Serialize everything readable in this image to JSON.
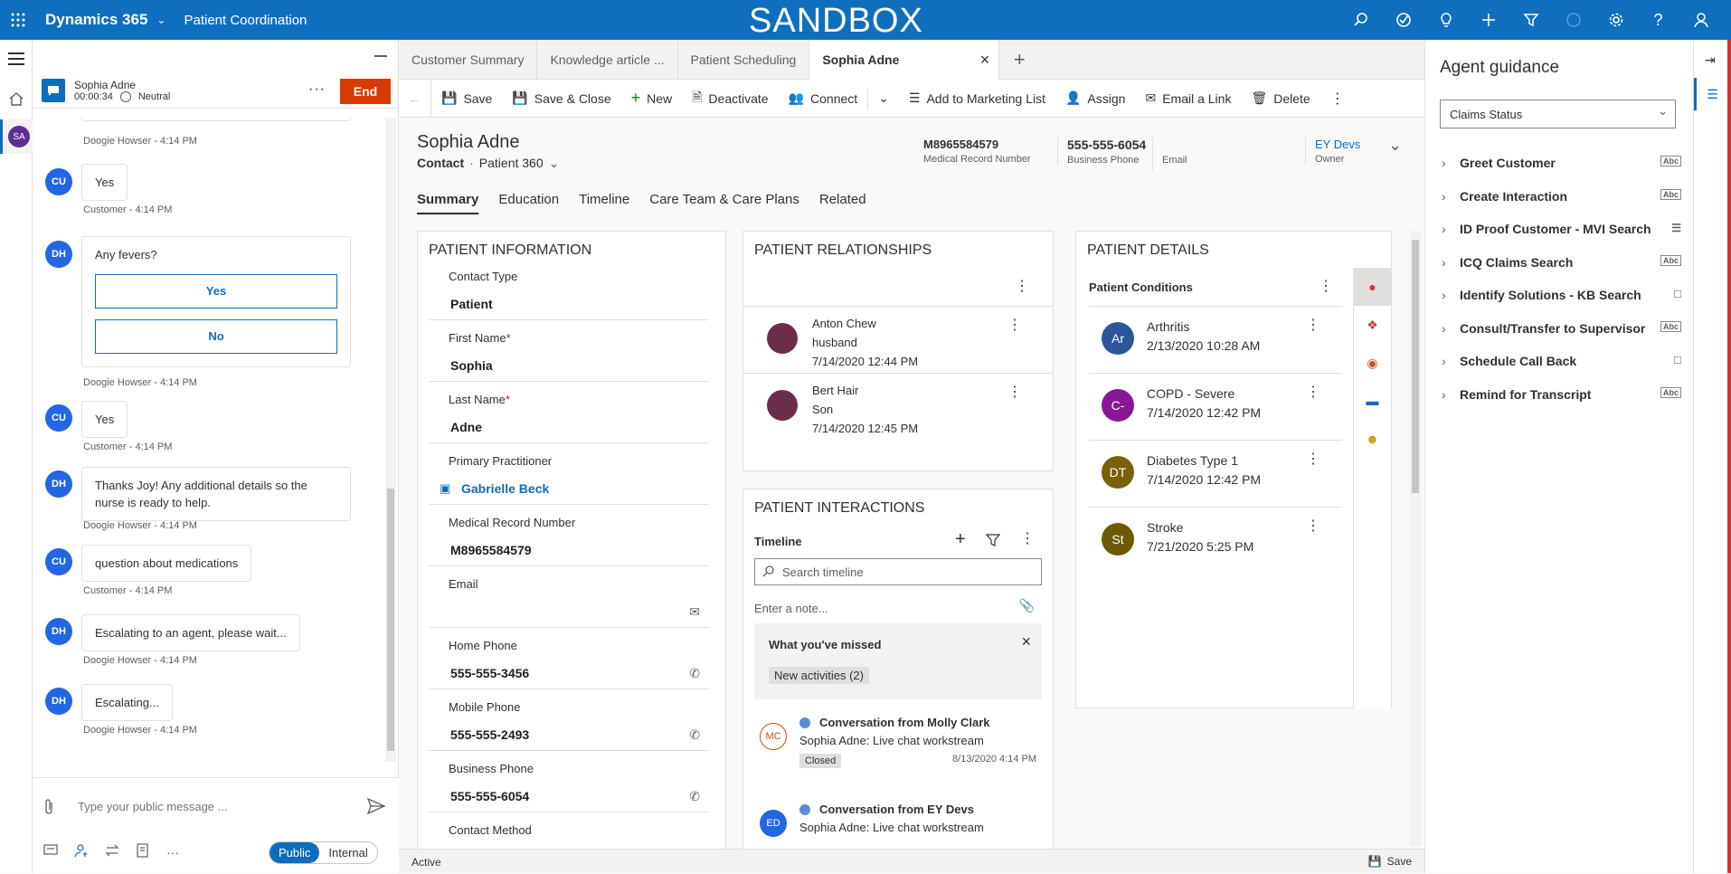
{
  "topbar": {
    "app_name": "Dynamics 365",
    "area": "Patient Coordination",
    "environment": "SANDBOX",
    "icons": [
      "search-icon",
      "task-icon",
      "lightbulb-icon",
      "plus-icon",
      "filter-icon",
      "help-circle-icon",
      "gear-icon",
      "question-icon",
      "person-icon"
    ]
  },
  "session": {
    "name": "Sophia Adne",
    "timer": "00:00:34",
    "sentiment": "Neutral",
    "end_label": "End"
  },
  "chat": {
    "messages": [
      {
        "initials": "CU",
        "text": "Yes",
        "meta": "Customer - 4:14 PM"
      },
      {
        "initials": "DH",
        "text": "Any fevers?",
        "options": [
          "Yes",
          "No"
        ],
        "meta": "Doogie Howser - 4:14 PM"
      },
      {
        "initials": "CU",
        "text": "Yes",
        "meta": "Customer - 4:14 PM"
      },
      {
        "initials": "DH",
        "text": "Thanks Joy! Any additional details so the nurse is ready to help.",
        "meta": "Doogie Howser - 4:14 PM"
      },
      {
        "initials": "CU",
        "text": "question about medications",
        "meta": "Customer - 4:14 PM"
      },
      {
        "initials": "DH",
        "text": "Escalating to an agent, please wait...",
        "meta": "Doogie Howser - 4:14 PM"
      },
      {
        "initials": "DH",
        "text": "Escalating...",
        "meta": "Doogie Howser - 4:14 PM"
      }
    ],
    "top_meta": "Doogie Howser - 4:14 PM",
    "composer_placeholder": "Type your public message ...",
    "public_label": "Public",
    "internal_label": "Internal"
  },
  "tabs": [
    "Customer Summary",
    "Knowledge article ...",
    "Patient Scheduling",
    "Sophia Adne"
  ],
  "commands": [
    "Save",
    "Save & Close",
    "New",
    "Deactivate",
    "Connect",
    "Add to Marketing List",
    "Assign",
    "Email a Link",
    "Delete"
  ],
  "record": {
    "name": "Sophia Adne",
    "entity": "Contact",
    "form": "Patient 360",
    "mrn": "M8965584579",
    "mrn_label": "Medical Record Number",
    "phone": "555-555-6054",
    "phone_label": "Business Phone",
    "email_label": "Email",
    "owner": "EY Devs",
    "owner_label": "Owner"
  },
  "nav_tabs": [
    "Summary",
    "Education",
    "Timeline",
    "Care Team & Care Plans",
    "Related"
  ],
  "patient_info": {
    "title": "PATIENT INFORMATION",
    "contact_type_label": "Contact Type",
    "contact_type": "Patient",
    "first_name_label": "First Name",
    "first_name": "Sophia",
    "last_name_label": "Last Name",
    "last_name": "Adne",
    "practitioner_label": "Primary Practitioner",
    "practitioner": "Gabrielle Beck",
    "mrn_label": "Medical Record Number",
    "mrn": "M8965584579",
    "email_label": "Email",
    "home_phone_label": "Home Phone",
    "home_phone": "555-555-3456",
    "mobile_phone_label": "Mobile Phone",
    "mobile_phone": "555-555-2493",
    "business_phone_label": "Business Phone",
    "business_phone": "555-555-6054",
    "contact_method_label": "Contact Method"
  },
  "relationships": {
    "title": "PATIENT RELATIONSHIPS",
    "items": [
      {
        "name": "Anton Chew",
        "role": "husband",
        "date": "7/14/2020 12:44 PM"
      },
      {
        "name": "Bert Hair",
        "role": "Son",
        "date": "7/14/2020 12:45 PM"
      }
    ]
  },
  "interactions": {
    "title": "PATIENT INTERACTIONS",
    "timeline_label": "Timeline",
    "search_placeholder": "Search timeline",
    "note_placeholder": "Enter a note...",
    "missed_title": "What you've missed",
    "missed_badge": "New activities (2)",
    "items": [
      {
        "initials": "MC",
        "title": "Conversation from Molly Clark",
        "sub": "Sophia Adne: Live chat workstream",
        "status": "Closed",
        "date": "8/13/2020 4:14 PM"
      },
      {
        "initials": "ED",
        "title": "Conversation from EY Devs",
        "sub": "Sophia Adne: Live chat workstream"
      }
    ]
  },
  "details": {
    "title": "PATIENT DETAILS",
    "conditions_label": "Patient Conditions",
    "conditions": [
      {
        "initials": "Ar",
        "name": "Arthritis",
        "date": "2/13/2020 10:28 AM",
        "color": "#2b579a"
      },
      {
        "initials": "C-",
        "name": "COPD - Severe",
        "date": "7/14/2020 12:42 PM",
        "color": "#881798"
      },
      {
        "initials": "DT",
        "name": "Diabetes Type 1",
        "date": "7/14/2020 12:42 PM",
        "color": "#7a6006"
      },
      {
        "initials": "St",
        "name": "Stroke",
        "date": "7/21/2020 5:25 PM",
        "color": "#6b5a00"
      }
    ]
  },
  "status": {
    "state": "Active",
    "save_label": "Save"
  },
  "guidance": {
    "title": "Agent guidance",
    "selected": "Claims Status",
    "items": [
      {
        "label": "Greet Customer",
        "icon": "Abc"
      },
      {
        "label": "Create Interaction",
        "icon": "Abc"
      },
      {
        "label": "ID Proof Customer - MVI Search",
        "icon": "list"
      },
      {
        "label": "ICQ Claims Search",
        "icon": "Abc"
      },
      {
        "label": "Identify Solutions - KB Search",
        "icon": "page"
      },
      {
        "label": "Consult/Transfer to Supervisor",
        "icon": "Abc"
      },
      {
        "label": "Schedule Call Back",
        "icon": "page"
      },
      {
        "label": "Remind for Transcript",
        "icon": "Abc"
      }
    ]
  }
}
